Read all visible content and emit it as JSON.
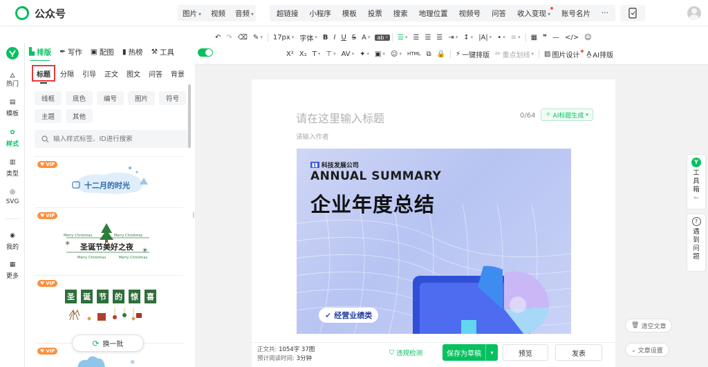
{
  "brand": {
    "name": "公众号"
  },
  "insert_menu": {
    "group1": [
      {
        "label": "图片",
        "dropdown": true
      },
      {
        "label": "视频",
        "dropdown": false
      },
      {
        "label": "音频",
        "dropdown": true
      }
    ],
    "group2": [
      {
        "label": "超链接",
        "dropdown": false,
        "dot": false
      },
      {
        "label": "小程序",
        "dropdown": false,
        "dot": false
      },
      {
        "label": "模板",
        "dropdown": false,
        "dot": false
      },
      {
        "label": "投票",
        "dropdown": false,
        "dot": false
      },
      {
        "label": "搜索",
        "dropdown": false,
        "dot": false
      },
      {
        "label": "地理位置",
        "dropdown": false,
        "dot": false
      },
      {
        "label": "视频号",
        "dropdown": false,
        "dot": false
      },
      {
        "label": "问答",
        "dropdown": false,
        "dot": false
      },
      {
        "label": "收入变现",
        "dropdown": true,
        "dot": true
      },
      {
        "label": "账号名片",
        "dropdown": false,
        "dot": false
      },
      {
        "label": "···",
        "dropdown": false,
        "dot": false
      }
    ]
  },
  "toolbar": {
    "font_size": "17px",
    "font": "字体",
    "bold": "B",
    "italic": "I",
    "underline": "U",
    "strike": "S",
    "font_color": "A",
    "superscript": "X²",
    "subscript": "X₂",
    "one_key_layout": "一键排版",
    "highlight_line": "重点划线",
    "image_design": "图片设计",
    "ai_layout": "AI排版"
  },
  "plugin_tabs": [
    {
      "label": "排版",
      "icon": "layout-icon",
      "active": true
    },
    {
      "label": "写作",
      "icon": "pen-icon",
      "active": false
    },
    {
      "label": "配图",
      "icon": "image-icon",
      "active": false
    },
    {
      "label": "热榜",
      "icon": "book-icon",
      "active": false
    },
    {
      "label": "工具",
      "icon": "tool-icon",
      "active": false
    }
  ],
  "left_nav": [
    {
      "label": "热门",
      "icon": "fire-icon",
      "active": false
    },
    {
      "label": "模板",
      "icon": "template-icon",
      "active": false
    },
    {
      "label": "样式",
      "icon": "style-icon",
      "active": true
    },
    {
      "label": "类型",
      "icon": "type-icon",
      "active": false
    },
    {
      "label": "SVG",
      "icon": "svg-icon",
      "active": false
    },
    {
      "label": "我的",
      "icon": "user-icon",
      "active": false
    },
    {
      "label": "更多",
      "icon": "grid-icon",
      "active": false
    }
  ],
  "category_tabs": [
    {
      "label": "标题",
      "active": true
    },
    {
      "label": "分隔",
      "active": false
    },
    {
      "label": "引导",
      "active": false
    },
    {
      "label": "正文",
      "active": false
    },
    {
      "label": "图文",
      "active": false
    },
    {
      "label": "问答",
      "active": false
    },
    {
      "label": "背景",
      "active": false
    }
  ],
  "chips": [
    "线框",
    "底色",
    "编号",
    "图片",
    "符号",
    "主题",
    "其他"
  ],
  "search": {
    "placeholder": "输入样式标签、ID进行搜索"
  },
  "style_cards": [
    {
      "badge": "VIP",
      "title": "十二月的时光"
    },
    {
      "badge": "VIP",
      "title": "圣诞节美好之夜",
      "sub": "Merry Christmas"
    },
    {
      "badge": "VIP",
      "chars": [
        "圣",
        "诞",
        "节",
        "的",
        "惊",
        "喜"
      ]
    },
    {
      "badge": "VIP"
    }
  ],
  "swap_button": {
    "label": "换一批"
  },
  "editor": {
    "title_placeholder": "请在这里输入标题",
    "title_count": "0/64",
    "ai_title_button": "AI标题生成",
    "author_placeholder": "请输入作者"
  },
  "cover": {
    "company": "科技发展公司",
    "headline_en": "ANNUAL SUMMARY",
    "headline_cn": "企业年度总结",
    "pill": "经营业绩类"
  },
  "footer": {
    "word_count_label": "正文共:",
    "word_count": "1054字 37图",
    "read_time_label": "预计阅读时间:",
    "read_time": "3分钟",
    "check": "违规检测",
    "save": "保存为草稿",
    "preview": "预览",
    "publish": "发表"
  },
  "right_panel": {
    "toolbox": [
      "工",
      "具",
      "箱"
    ],
    "help": [
      "遇",
      "到",
      "问",
      "题"
    ],
    "clear": "清空文章",
    "settings": "文章设置"
  },
  "colors": {
    "accent": "#07c160",
    "danger": "#fa5151",
    "vip": "#ff8f3c",
    "cover_blue": "#3b5bdb"
  }
}
